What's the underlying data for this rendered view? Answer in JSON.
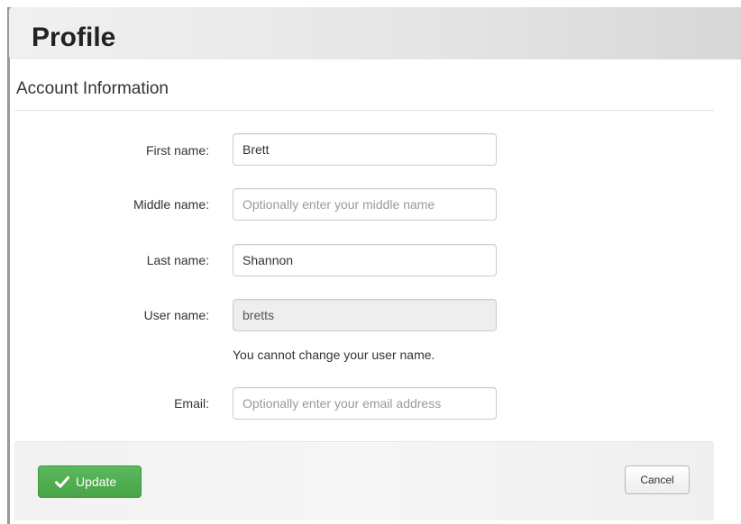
{
  "header": {
    "title": "Profile"
  },
  "section": {
    "title": "Account Information"
  },
  "form": {
    "first_name": {
      "label": "First name:",
      "value": "Brett",
      "placeholder": ""
    },
    "middle_name": {
      "label": "Middle name:",
      "value": "",
      "placeholder": "Optionally enter your middle name"
    },
    "last_name": {
      "label": "Last name:",
      "value": "Shannon",
      "placeholder": ""
    },
    "user_name": {
      "label": "User name:",
      "value": "bretts",
      "help": "You cannot change your user name.",
      "disabled": true
    },
    "email": {
      "label": "Email:",
      "value": "",
      "placeholder": "Optionally enter your email address"
    }
  },
  "actions": {
    "update_label": "Update",
    "update_icon": "checkmark-icon",
    "cancel_label": "Cancel",
    "update_color": "#5cb85c"
  }
}
